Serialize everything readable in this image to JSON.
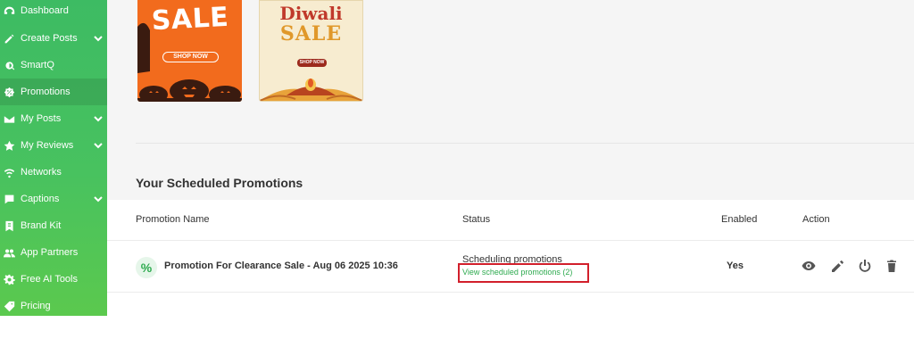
{
  "sidebar": {
    "items": [
      {
        "label": "Dashboard",
        "icon": "dashboard-icon",
        "chevron": false,
        "active": false
      },
      {
        "label": "Create Posts",
        "icon": "pencil-icon",
        "chevron": true,
        "active": false
      },
      {
        "label": "SmartQ",
        "icon": "smartq-icon",
        "chevron": false,
        "active": false
      },
      {
        "label": "Promotions",
        "icon": "promotions-icon",
        "chevron": false,
        "active": true
      },
      {
        "label": "My Posts",
        "icon": "envelope-icon",
        "chevron": true,
        "active": false
      },
      {
        "label": "My Reviews",
        "icon": "star-icon",
        "chevron": true,
        "active": false
      },
      {
        "label": "Networks",
        "icon": "wifi-icon",
        "chevron": false,
        "active": false
      },
      {
        "label": "Captions",
        "icon": "chat-icon",
        "chevron": true,
        "active": false
      },
      {
        "label": "Brand Kit",
        "icon": "brand-kit-icon",
        "chevron": false,
        "active": false
      },
      {
        "label": "App Partners",
        "icon": "partners-icon",
        "chevron": false,
        "active": false
      },
      {
        "label": "Free AI Tools",
        "icon": "gear-icon",
        "chevron": false,
        "active": false
      },
      {
        "label": "Pricing",
        "icon": "tag-icon",
        "chevron": false,
        "active": false
      }
    ]
  },
  "templates": {
    "halloween": {
      "title": "SALE",
      "button": "SHOP NOW"
    },
    "diwali": {
      "title": "Diwali",
      "subtitle": "SALE",
      "button": "SHOP NOW"
    }
  },
  "scheduled": {
    "title": "Your Scheduled Promotions",
    "columns": {
      "name": "Promotion Name",
      "status": "Status",
      "enabled": "Enabled",
      "action": "Action"
    },
    "rows": [
      {
        "icon": "percent-icon",
        "icon_glyph": "%",
        "name": "Promotion For Clearance Sale - Aug 06 2025 10:36",
        "status": "Scheduling promotions",
        "link": "View scheduled promotions (2)",
        "enabled": "Yes",
        "actions": [
          "eye-icon",
          "edit-icon",
          "power-icon",
          "trash-icon"
        ]
      }
    ]
  },
  "colors": {
    "brand_green": "#3dbb63",
    "link_green": "#2eaa4f",
    "highlight_red": "#d21f2b",
    "poster_orange": "#f26b1d"
  }
}
